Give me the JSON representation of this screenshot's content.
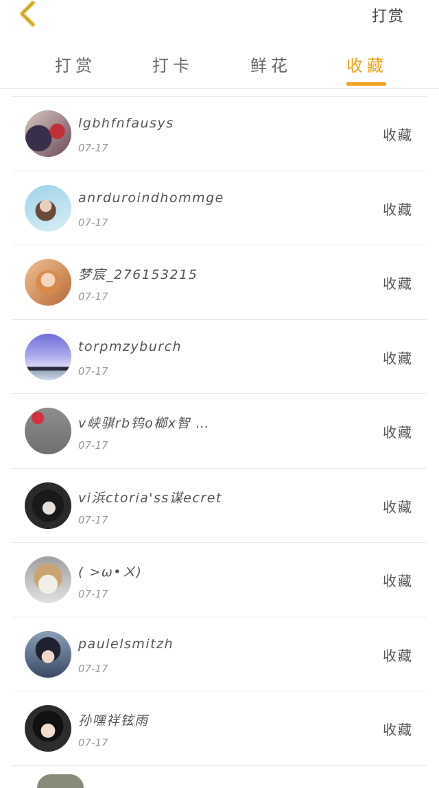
{
  "header": {
    "back_icon": "chevron-left-icon",
    "action_label": "打赏",
    "accent_color": "#F0A31E"
  },
  "tabs": [
    {
      "label": "打赏",
      "active": false
    },
    {
      "label": "打卡",
      "active": false
    },
    {
      "label": "鲜花",
      "active": false
    },
    {
      "label": "收藏",
      "active": true
    }
  ],
  "list": {
    "items": [
      {
        "name": "lgbhfnfausys",
        "date": "07-17",
        "action": "收藏"
      },
      {
        "name": "anrduroindhommge",
        "date": "07-17",
        "action": "收藏"
      },
      {
        "name": "梦宸_276153215",
        "date": "07-17",
        "action": "收藏"
      },
      {
        "name": "torpmzyburch",
        "date": "07-17",
        "action": "收藏"
      },
      {
        "name": "v峡骐rb钨o榔x智 …",
        "date": "07-17",
        "action": "收藏"
      },
      {
        "name": "vi浜ctoria'ss谋ecret",
        "date": "07-17",
        "action": "收藏"
      },
      {
        "name": "( >ω•ㄨ)",
        "date": "07-17",
        "action": "收藏"
      },
      {
        "name": "paulelsmitzh",
        "date": "07-17",
        "action": "收藏"
      },
      {
        "name": "孙嘿祥铉雨",
        "date": "07-17",
        "action": "收藏"
      }
    ]
  }
}
